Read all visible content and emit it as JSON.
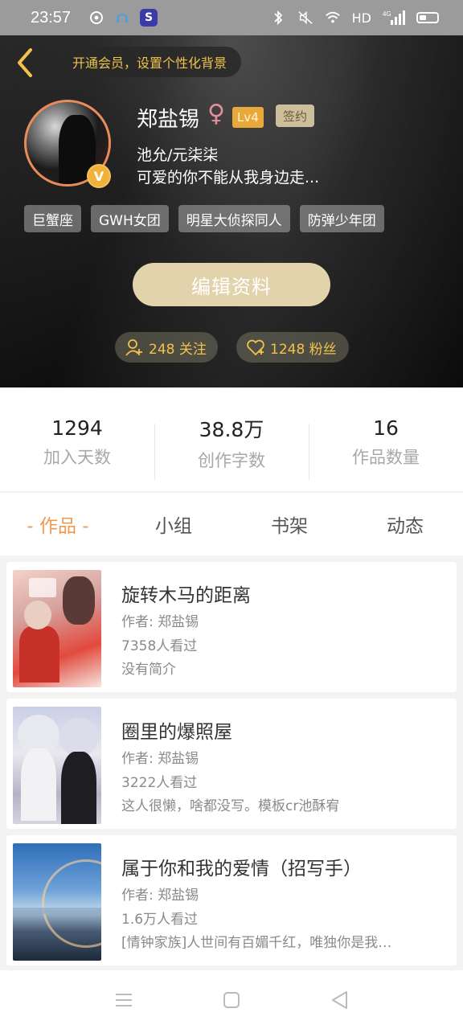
{
  "status_bar": {
    "time": "23:57",
    "network_label": "HD",
    "signal_label": "4G"
  },
  "header": {
    "vip_prompt": "开通会员，设置个性化背景",
    "username": "郑盐锡",
    "gender_symbol": "♀",
    "level": "Lv4",
    "signed_badge": "签约",
    "avatar_badge": "V",
    "bio_line1": "池允/元柒柒",
    "bio_line2": "可爱的你不能从我身边走...",
    "tags": [
      "巨蟹座",
      "GWH女团",
      "明星大侦探同人",
      "防弹少年团"
    ],
    "edit_button": "编辑资料",
    "following_label": "248 关注",
    "fans_label": "1248 粉丝"
  },
  "stats": [
    {
      "value": "1294",
      "label": "加入天数"
    },
    {
      "value": "38.8万",
      "label": "创作字数"
    },
    {
      "value": "16",
      "label": "作品数量"
    }
  ],
  "tabs": [
    "- 作品 -",
    "小组",
    "书架",
    "动态"
  ],
  "books": [
    {
      "title": "旋转木马的距离",
      "author": "作者: 郑盐锡",
      "views": "7358人看过",
      "intro": "没有简介"
    },
    {
      "title": "圈里的爆照屋",
      "author": "作者: 郑盐锡",
      "views": "3222人看过",
      "intro": "这人很懒，啥都没写。模板cr池酥宥"
    },
    {
      "title": "属于你和我的爱情（招写手）",
      "author": "作者: 郑盐锡",
      "views": "1.6万人看过",
      "intro": "[情钟家族]人世间有百媚千红，唯独你是我…"
    }
  ],
  "colors": {
    "accent": "#ef9a50",
    "gold": "#f2c24d",
    "edit_button": "#e3d3ad"
  }
}
